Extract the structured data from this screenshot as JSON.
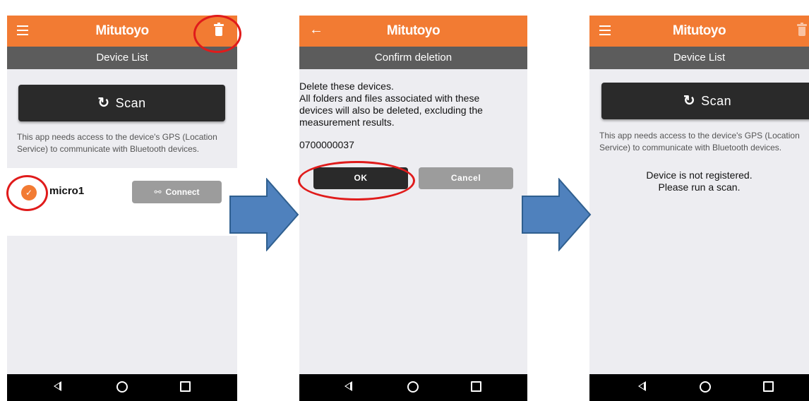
{
  "colors": {
    "app_bar": "#f27b33",
    "sub_bar": "#5c5c5c",
    "background": "#ededf1",
    "primary_button": "#2a2a2a",
    "secondary_button": "#9c9c9c",
    "highlight": "#e01b1b",
    "flow_arrow": "#4f81bd"
  },
  "screen1": {
    "logo": "Mitutoyo",
    "menu_icon": "menu-icon",
    "action_icon": "trash-icon",
    "title": "Device List",
    "scan_label": "Scan",
    "scan_icon": "refresh-icon",
    "info_text": "This app needs access to the device's GPS (Location Service) to communicate with Bluetooth devices.",
    "device": {
      "name": "micro1",
      "selected": true,
      "connect_label": "Connect",
      "connect_icon": "link-off-icon"
    }
  },
  "screen2": {
    "logo": "Mitutoyo",
    "back_icon": "arrow-left-icon",
    "title": "Confirm deletion",
    "message_line1": "Delete these devices.",
    "message_line2": "All folders and files associated with these devices will also be deleted, excluding the measurement results.",
    "serial": "0700000037",
    "ok_label": "OK",
    "cancel_label": "Cancel"
  },
  "screen3": {
    "logo": "Mitutoyo",
    "menu_icon": "menu-icon",
    "action_icon": "trash-icon",
    "title": "Device List",
    "scan_label": "Scan",
    "scan_icon": "refresh-icon",
    "info_text": "This app needs access to the device's GPS (Location Service) to communicate with Bluetooth devices.",
    "empty_line1": "Device is not registered.",
    "empty_line2": "Please run a scan."
  },
  "nav_bar": {
    "back_icon": "nav-back-icon",
    "home_icon": "nav-home-icon",
    "recent_icon": "nav-recent-icon"
  }
}
